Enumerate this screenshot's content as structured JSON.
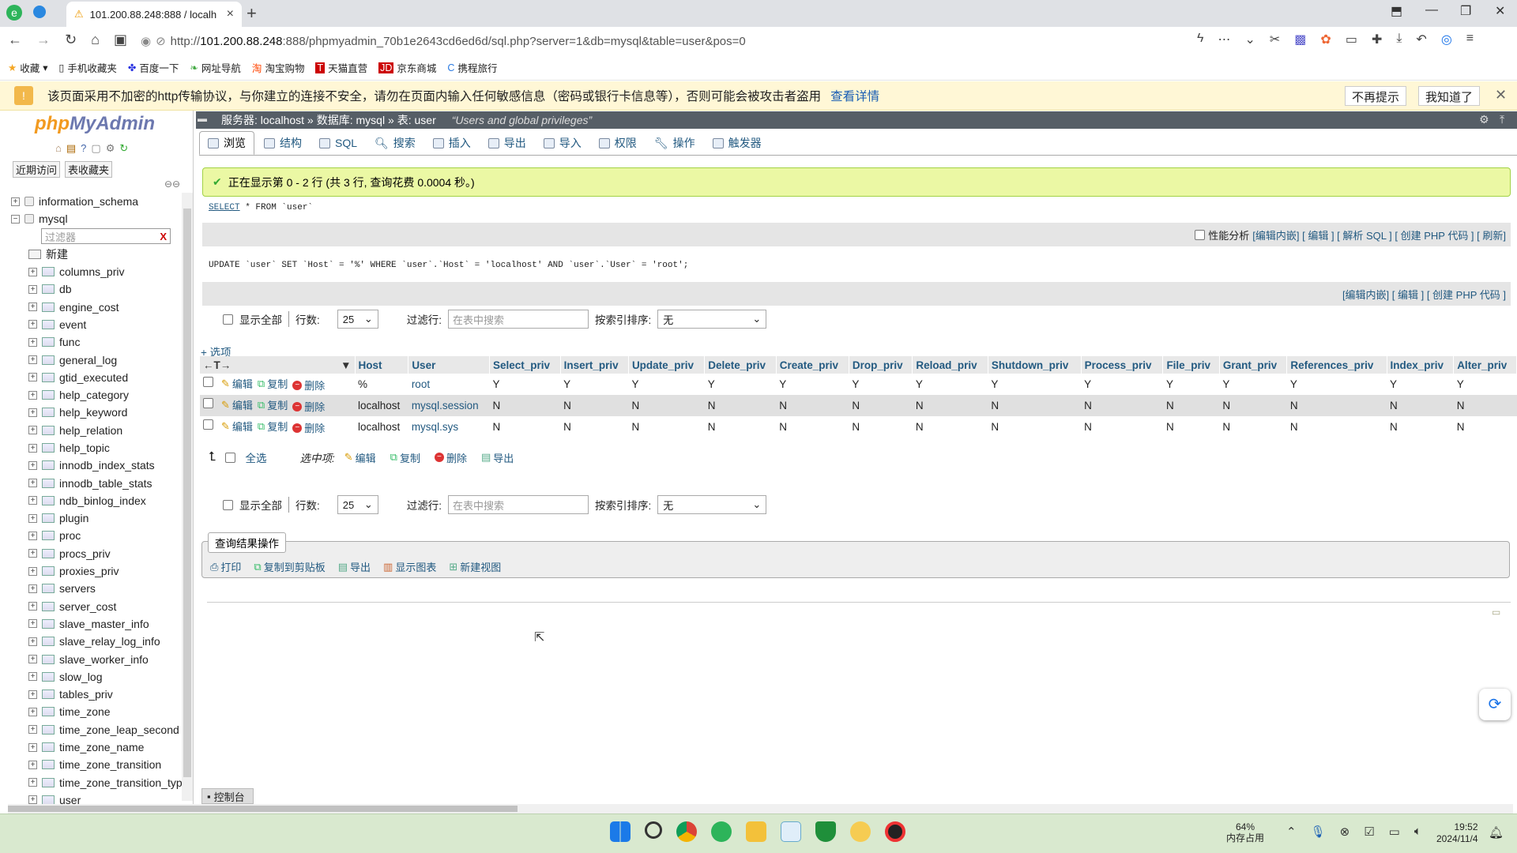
{
  "browser": {
    "tab_title": "101.200.88.248:888 / localh",
    "url_prefix": "http://",
    "url_host": "101.200.88.248",
    "url_rest": ":888/phpmyadmin_70b1e2643cd6ed6d/sql.php?server=1&db=mysql&table=user&pos=0"
  },
  "bookmarks": [
    "收藏",
    "手机收藏夹",
    "百度一下",
    "网址导航",
    "淘宝购物",
    "天猫直营",
    "京东商城",
    "携程旅行"
  ],
  "warning": {
    "text": "该页面采用不加密的http传输协议，与你建立的连接不安全，请勿在页面内输入任何敏感信息（密码或银行卡信息等），否则可能会被攻击者盗用",
    "link": "查看详情",
    "btn_dismiss": "不再提示",
    "btn_ok": "我知道了"
  },
  "sidebar": {
    "logo_php": "php",
    "logo_my": "MyAdmin",
    "recent": "近期访问",
    "favorites": "表收藏夹",
    "filter_placeholder": "过滤器",
    "filter_clear": "X",
    "db_information_schema": "information_schema",
    "db_mysql": "mysql",
    "new_label": "新建",
    "tables": [
      "columns_priv",
      "db",
      "engine_cost",
      "event",
      "func",
      "general_log",
      "gtid_executed",
      "help_category",
      "help_keyword",
      "help_relation",
      "help_topic",
      "innodb_index_stats",
      "innodb_table_stats",
      "ndb_binlog_index",
      "plugin",
      "proc",
      "procs_priv",
      "proxies_priv",
      "servers",
      "server_cost",
      "slave_master_info",
      "slave_relay_log_info",
      "slave_worker_info",
      "slow_log",
      "tables_priv",
      "time_zone",
      "time_zone_leap_second",
      "time_zone_name",
      "time_zone_transition",
      "time_zone_transition_typ",
      "user"
    ]
  },
  "breadcrumb": {
    "server": "服务器: localhost »",
    "database": "数据库: mysql »",
    "table": "表: user",
    "comment": "“Users and global privileges”"
  },
  "tabs": [
    "浏览",
    "结构",
    "SQL",
    "搜索",
    "插入",
    "导出",
    "导入",
    "权限",
    "操作",
    "触发器"
  ],
  "success": "正在显示第 0 - 2 行 (共 3 行, 查询花费 0.0004 秒。)",
  "sql1": {
    "kw1": "SELECT",
    "rest": " * FROM `user`"
  },
  "bar1": {
    "profiling": "性能分析",
    "links": "[编辑内嵌] [ 编辑 ] [ 解析 SQL ] [ 创建 PHP 代码 ] [ 刷新]"
  },
  "sql2": "UPDATE `user` SET `Host` = '%' WHERE `user`.`Host` = 'localhost' AND `user`.`User` = 'root';",
  "bar2": {
    "links": "[编辑内嵌] [ 编辑 ] [ 创建 PHP 代码 ]"
  },
  "nav": {
    "show_all": "显示全部",
    "rows_label": "行数:",
    "rows_value": "25",
    "filter_label": "过滤行:",
    "filter_placeholder": "在表中搜索",
    "sort_label": "按索引排序:",
    "sort_value": "无"
  },
  "options_link": "+ 选项",
  "table": {
    "headers": [
      "Host",
      "User",
      "Select_priv",
      "Insert_priv",
      "Update_priv",
      "Delete_priv",
      "Create_priv",
      "Drop_priv",
      "Reload_priv",
      "Shutdown_priv",
      "Process_priv",
      "File_priv",
      "Grant_priv",
      "References_priv",
      "Index_priv",
      "Alter_priv"
    ],
    "actions": {
      "edit": "编辑",
      "copy": "复制",
      "delete": "删除"
    },
    "rows": [
      [
        "%",
        "root",
        "Y",
        "Y",
        "Y",
        "Y",
        "Y",
        "Y",
        "Y",
        "Y",
        "Y",
        "Y",
        "Y",
        "Y",
        "Y",
        "Y"
      ],
      [
        "localhost",
        "mysql.session",
        "N",
        "N",
        "N",
        "N",
        "N",
        "N",
        "N",
        "N",
        "N",
        "N",
        "N",
        "N",
        "N",
        "N"
      ],
      [
        "localhost",
        "mysql.sys",
        "N",
        "N",
        "N",
        "N",
        "N",
        "N",
        "N",
        "N",
        "N",
        "N",
        "N",
        "N",
        "N",
        "N"
      ]
    ]
  },
  "bulk": {
    "select_all": "全选",
    "with_selected": "选中项:",
    "edit": "编辑",
    "copy": "复制",
    "delete": "删除",
    "export": "导出"
  },
  "result_ops": {
    "title": "查询结果操作",
    "print": "打印",
    "copy_clipboard": "复制到剪贴板",
    "export": "导出",
    "chart": "显示图表",
    "create_view": "新建视图"
  },
  "console": "控制台",
  "taskbar": {
    "mem_pct": "64%",
    "mem_label": "内存占用",
    "time": "19:52",
    "date": "2024/11/4"
  }
}
